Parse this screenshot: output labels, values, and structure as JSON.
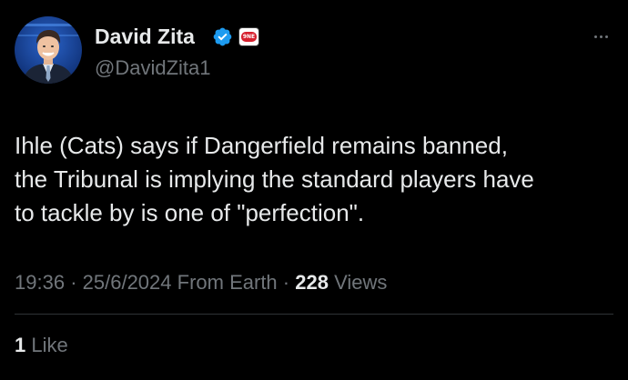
{
  "author": {
    "name": "David Zita",
    "handle": "@DavidZita1",
    "verified_icon": "verified-badge-icon",
    "affiliate_badge_icon": "network-logo-icon",
    "affiliate_badge_text": "9NE"
  },
  "tweet": {
    "lines": [
      "Ihle (Cats) says if Dangerfield remains banned,",
      "the Tribunal is implying the standard players have",
      "to tackle by is one of \"perfection\"."
    ]
  },
  "meta": {
    "time": "19:36",
    "date": "25/6/2024",
    "source": "From Earth",
    "separator": "·",
    "views_count": "228",
    "views_label": "Views"
  },
  "engagement": {
    "likes_count": "1",
    "likes_label": "Like"
  },
  "colors": {
    "background": "#000000",
    "text_primary": "#e7e9ea",
    "text_secondary": "#71767b",
    "verified_blue": "#1d9bf0",
    "divider": "#2f3336",
    "badge_red": "#d6202e"
  }
}
